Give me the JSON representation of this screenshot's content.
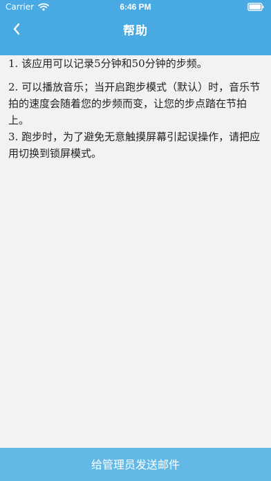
{
  "status": {
    "carrier": "Carrier",
    "time": "6:46 PM",
    "wifi_icon": "wifi-icon",
    "battery_icon": "battery-icon"
  },
  "nav": {
    "title": "帮助",
    "back_icon": "chevron-left-icon"
  },
  "help": {
    "items": [
      "1. 该应用可以记录5分钟和50分钟的步频。",
      "2. 可以播放音乐；当开启跑步模式（默认）时，音乐节拍的速度会随着您的步频而变，让您的步点踏在节拍上。",
      "3. 跑步时，为了避免无意触摸屏幕引起误操作，请把应用切换到锁屏模式。"
    ]
  },
  "footer": {
    "email_button_label": "给管理员发送邮件"
  },
  "colors": {
    "nav_bg": "#49a9e2",
    "button_bg": "#63b9e6",
    "page_bg": "#f2f2f2"
  }
}
